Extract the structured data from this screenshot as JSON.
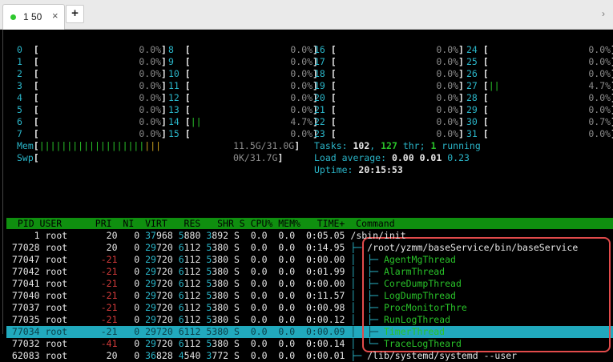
{
  "tab": {
    "title": "1 50",
    "close": "×",
    "add": "+"
  },
  "cpus": [
    [
      "0",
      "0.0%"
    ],
    [
      "1",
      "0.0%"
    ],
    [
      "2",
      "0.0%"
    ],
    [
      "3",
      "0.0%"
    ],
    [
      "4",
      "0.0%"
    ],
    [
      "5",
      "0.0%"
    ],
    [
      "6",
      "0.0%"
    ],
    [
      "7",
      "0.0%"
    ],
    [
      "8",
      "0.0%"
    ],
    [
      "9",
      "0.0%"
    ],
    [
      "10",
      "0.0%"
    ],
    [
      "11",
      "0.0%"
    ],
    [
      "12",
      "0.0%"
    ],
    [
      "13",
      "0.0%"
    ],
    [
      "14",
      "4.7%"
    ],
    [
      "15",
      "0.0%"
    ],
    [
      "16",
      "0.0%"
    ],
    [
      "17",
      "0.0%"
    ],
    [
      "18",
      "0.0%"
    ],
    [
      "19",
      "0.0%"
    ],
    [
      "20",
      "0.0%"
    ],
    [
      "21",
      "0.0%"
    ],
    [
      "22",
      "0.0%"
    ],
    [
      "23",
      "0.0%"
    ],
    [
      "24",
      "0.0%"
    ],
    [
      "25",
      "0.0%"
    ],
    [
      "26",
      "0.0%"
    ],
    [
      "27",
      "4.7%"
    ],
    [
      "28",
      "0.0%"
    ],
    [
      "29",
      "0.0%"
    ],
    [
      "30",
      "0.7%"
    ],
    [
      "31",
      "0.0%"
    ]
  ],
  "mem": {
    "label": "Mem",
    "value": "11.5G/31.0G"
  },
  "swp": {
    "label": "Swp",
    "value": "0K/31.7G"
  },
  "tasks": {
    "label": "Tasks: ",
    "count": "102",
    "sep1": ", ",
    "thr": "127",
    "thr_label": " thr; ",
    "running": "1",
    "running_label": " running"
  },
  "load": {
    "label": "Load average: ",
    "a": "0.00",
    "b": "0.01",
    "c": "0.23"
  },
  "uptime": {
    "label": "Uptime: ",
    "value": "20:15:53"
  },
  "header": "  PID USER      PRI  NI  VIRT   RES   SHR S CPU% MEM%   TIME+  Command",
  "rows": [
    {
      "pid": "1",
      "user": "root",
      "pri": "20",
      "ni": "0",
      "virt": "37968",
      "res": "5880",
      "shr": "3892",
      "s": "S",
      "cpu": "0.0",
      "mem": "0.0",
      "time": "0:05.05",
      "tree": "",
      "cmd": "/sbin/init"
    },
    {
      "pid": "77028",
      "user": "root",
      "pri": "20",
      "ni": "0",
      "virt": "29720",
      "res": "6112",
      "shr": "5380",
      "s": "S",
      "cpu": "0.0",
      "mem": "0.0",
      "time": "0:14.95",
      "tree": "├─ ",
      "cmd": "/root/yzmm/baseService/bin/baseService"
    },
    {
      "pid": "77047",
      "user": "root",
      "pri": "-21",
      "ni": "0",
      "virt": "29720",
      "res": "6112",
      "shr": "5380",
      "s": "S",
      "cpu": "0.0",
      "mem": "0.0",
      "time": "0:00.00",
      "tree": "│  ├─ ",
      "cmd": "AgentMgThread"
    },
    {
      "pid": "77042",
      "user": "root",
      "pri": "-21",
      "ni": "0",
      "virt": "29720",
      "res": "6112",
      "shr": "5380",
      "s": "S",
      "cpu": "0.0",
      "mem": "0.0",
      "time": "0:01.99",
      "tree": "│  ├─ ",
      "cmd": "AlarmThread"
    },
    {
      "pid": "77041",
      "user": "root",
      "pri": "-21",
      "ni": "0",
      "virt": "29720",
      "res": "6112",
      "shr": "5380",
      "s": "S",
      "cpu": "0.0",
      "mem": "0.0",
      "time": "0:00.00",
      "tree": "│  ├─ ",
      "cmd": "CoreDumpThread"
    },
    {
      "pid": "77040",
      "user": "root",
      "pri": "-21",
      "ni": "0",
      "virt": "29720",
      "res": "6112",
      "shr": "5380",
      "s": "S",
      "cpu": "0.0",
      "mem": "0.0",
      "time": "0:11.57",
      "tree": "│  ├─ ",
      "cmd": "LogDumpThread"
    },
    {
      "pid": "77037",
      "user": "root",
      "pri": "-21",
      "ni": "0",
      "virt": "29720",
      "res": "6112",
      "shr": "5380",
      "s": "S",
      "cpu": "0.0",
      "mem": "0.0",
      "time": "0:00.98",
      "tree": "│  ├─ ",
      "cmd": "ProcMonitorThre"
    },
    {
      "pid": "77035",
      "user": "root",
      "pri": "-21",
      "ni": "0",
      "virt": "29720",
      "res": "6112",
      "shr": "5380",
      "s": "S",
      "cpu": "0.0",
      "mem": "0.0",
      "time": "0:00.12",
      "tree": "│  ├─ ",
      "cmd": "RunLogThread"
    },
    {
      "pid": "77034",
      "user": "root",
      "pri": "-21",
      "ni": "0",
      "virt": "29720",
      "res": "6112",
      "shr": "5380",
      "s": "S",
      "cpu": "0.0",
      "mem": "0.0",
      "time": "0:00.09",
      "tree": "│  ├─ ",
      "cmd": "TimerThread",
      "selected": true
    },
    {
      "pid": "77032",
      "user": "root",
      "pri": "-41",
      "ni": "0",
      "virt": "29720",
      "res": "6112",
      "shr": "5380",
      "s": "S",
      "cpu": "0.0",
      "mem": "0.0",
      "time": "0:00.14",
      "tree": "│  └─ ",
      "cmd": "TraceLogTheard"
    },
    {
      "pid": "62083",
      "user": "root",
      "pri": "20",
      "ni": "0",
      "virt": "36828",
      "res": "4540",
      "shr": "3772",
      "s": "S",
      "cpu": "0.0",
      "mem": "0.0",
      "time": "0:00.01",
      "tree": "├─ ",
      "cmd": "/lib/systemd/systemd --user"
    }
  ],
  "colors": {
    "terminal_bg": "#000000",
    "header_bar": "#0f8f0f",
    "selection": "#21a9bd",
    "highlight_box": "#e24b4b",
    "cyan": "#2ab5c8",
    "green": "#29c229"
  }
}
